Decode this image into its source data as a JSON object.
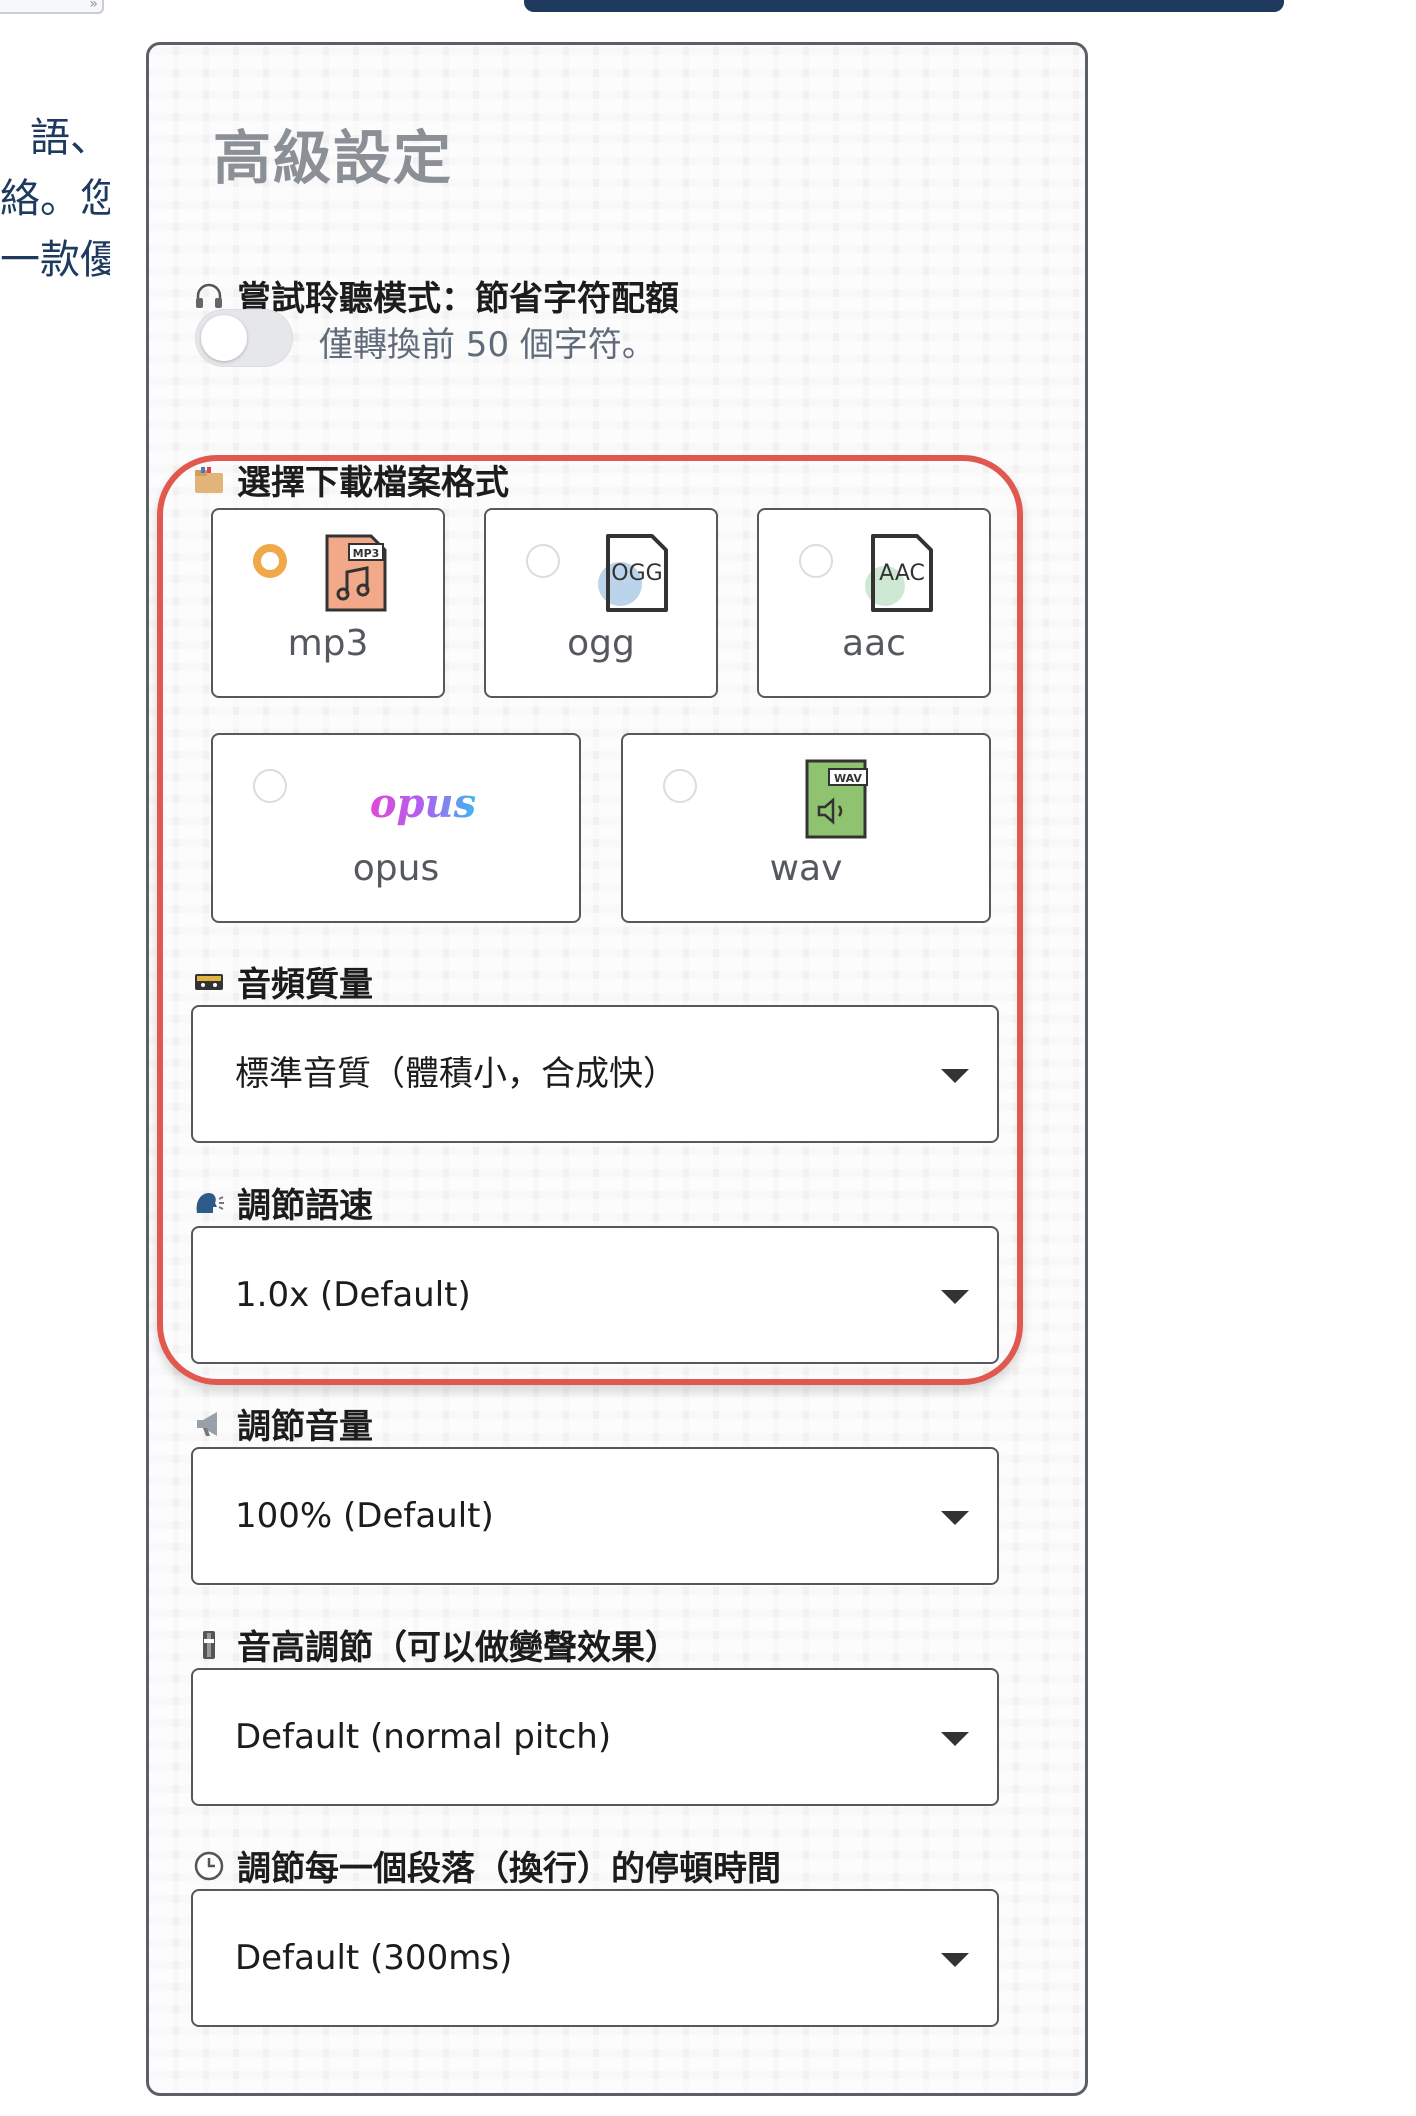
{
  "background_text": [
    "語、",
    "絡。您",
    "一款優"
  ],
  "top_left_glyph": "»",
  "panel": {
    "title": "高級設定",
    "trial": {
      "label": "嘗試聆聽模式：節省字符配額",
      "toggle_text": "僅轉換前 50 個字符。",
      "enabled": false
    },
    "format": {
      "label": "選擇下載檔案格式",
      "selected": "mp3",
      "options": [
        {
          "label": "mp3",
          "badge": "MP3",
          "icon": "mp3-file-icon"
        },
        {
          "label": "ogg",
          "badge": "OGG",
          "icon": "ogg-file-icon"
        },
        {
          "label": "aac",
          "badge": "AAC",
          "icon": "aac-file-icon"
        },
        {
          "label": "opus",
          "logo": "opus",
          "icon": "opus-logo-icon"
        },
        {
          "label": "wav",
          "badge": "WAV",
          "icon": "wav-file-icon"
        }
      ]
    },
    "quality": {
      "label": "音頻質量",
      "value": "標準音質（體積小，合成快）"
    },
    "speed": {
      "label": "調節語速",
      "value": "1.0x (Default)"
    },
    "volume": {
      "label": "調節音量",
      "value": "100% (Default)"
    },
    "pitch": {
      "label": "音高調節（可以做變聲效果）",
      "value": "Default (normal pitch)"
    },
    "pause": {
      "label": "調節每一個段落（換行）的停頓時間",
      "value": "Default (300ms)"
    }
  },
  "colors": {
    "accent": "#f0a94a",
    "highlight": "#e0584f",
    "navy": "#1e3a5f"
  }
}
